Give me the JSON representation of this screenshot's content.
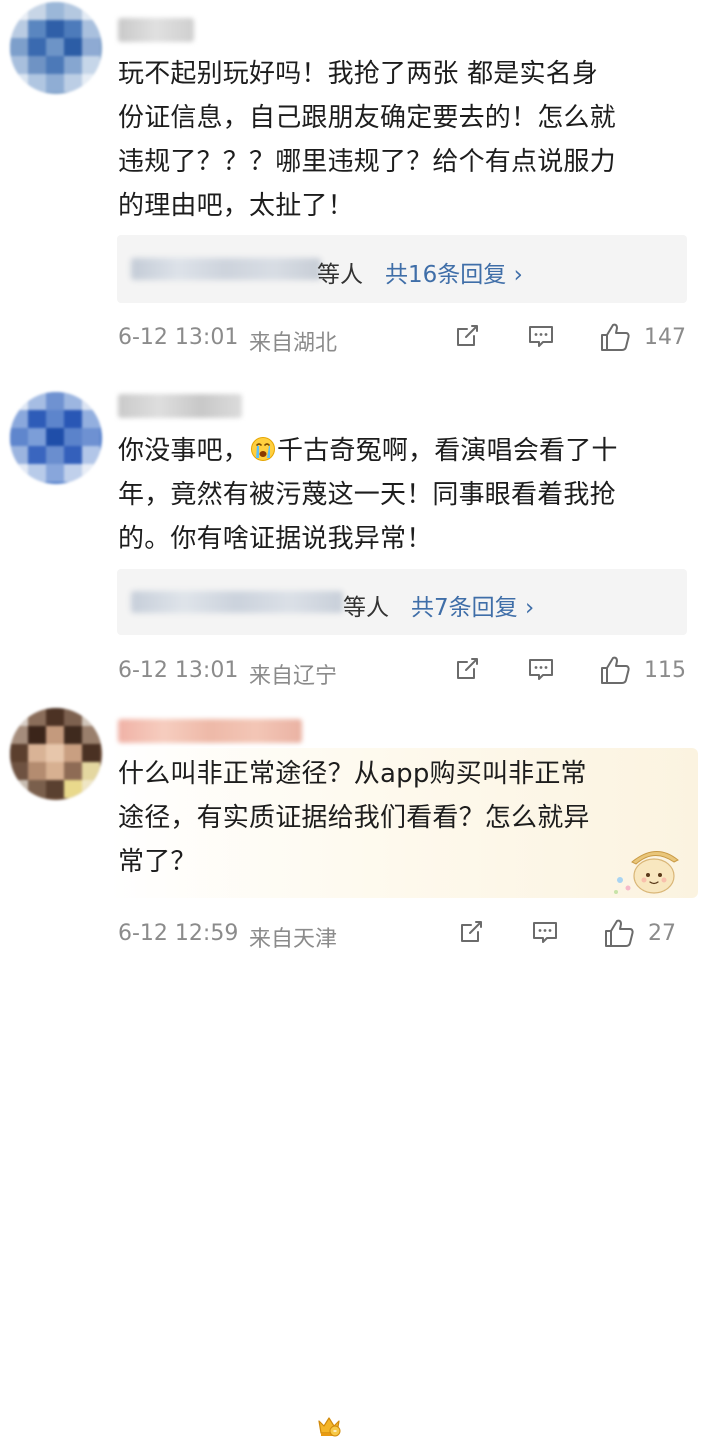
{
  "comments": [
    {
      "text_lines": [
        "玩不起别玩好吗！我抢了两张 都是实名身",
        "份证信息，自己跟朋友确定要去的！怎么就",
        "违规了？？？哪里违规了？给个有点说服力",
        "的理由吧，太扯了！"
      ],
      "others_label": "等人",
      "reply_total": "共16条回复 ›",
      "time": "6-12 13:01",
      "location": "来自湖北",
      "likes": "147"
    },
    {
      "text_pre": "你没事吧，",
      "text_post_first": "千古奇冤啊，看演唱会看了十",
      "text_lines": [
        "年，竟然有被污蔑这一天！同事眼看着我抢",
        "的。你有啥证据说我异常！"
      ],
      "emoji_name": "crying-face-emoji",
      "others_label": "等人",
      "reply_total": "共7条回复 ›",
      "time": "6-12 13:01",
      "location": "来自辽宁",
      "likes": "115"
    },
    {
      "text_lines": [
        "什么叫非正常途径？从app购买叫非正常",
        "途径，有实质证据给我们看看？怎么就异",
        "常了？"
      ],
      "time": "6-12 12:59",
      "location": "来自天津",
      "likes": "27"
    }
  ],
  "icons": {
    "share": "share-icon",
    "comment": "comment-icon",
    "like": "thumbs-up-icon",
    "vip": "vip-crown-icon"
  },
  "colors": {
    "link_blue": "#3f6ea8",
    "meta_gray": "#8b8b8b",
    "reply_bg": "#f4f4f4"
  }
}
